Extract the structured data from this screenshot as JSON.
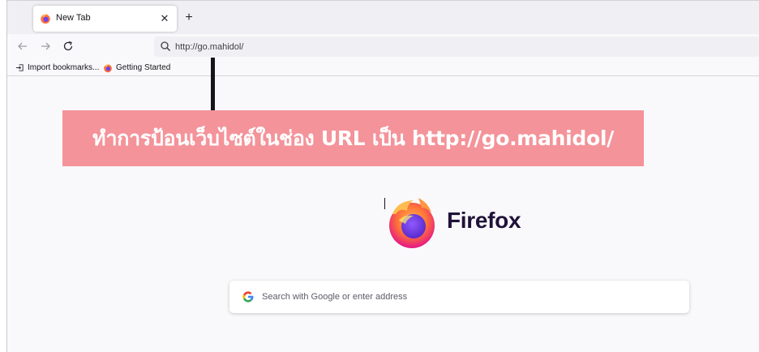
{
  "tabs": [
    {
      "title": "New Tab",
      "active": true,
      "favicon": "firefox-icon"
    }
  ],
  "navbar": {
    "back_icon": "arrow-left-icon",
    "forward_icon": "arrow-right-icon",
    "reload_icon": "reload-icon",
    "url_value": "http://go.mahidol/"
  },
  "bookmarks": [
    {
      "label": "Import bookmarks...",
      "icon": "import-icon"
    },
    {
      "label": "Getting Started",
      "icon": "firefox-icon"
    }
  ],
  "newtab": {
    "brand": "Firefox",
    "search_placeholder": "Search with Google or enter address"
  },
  "annotation": {
    "text": "ทำการป้อนเว็บไซต์ในช่อง URL เป็น http://go.mahidol/",
    "color": "#f4939a"
  },
  "colors": {
    "tabstrip_bg": "#f0f0f4",
    "wordmark": "#20123a"
  }
}
